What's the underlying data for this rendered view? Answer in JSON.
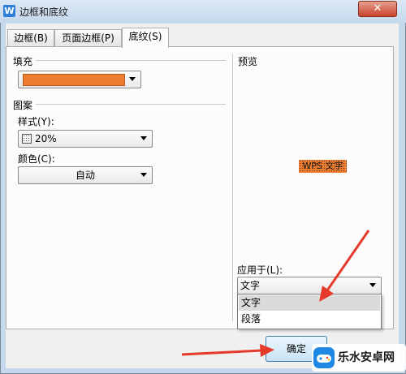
{
  "window": {
    "title": "边框和底纹",
    "close_glyph": "✕"
  },
  "tabs": [
    {
      "label": "边框(B)"
    },
    {
      "label": "页面边框(P)"
    },
    {
      "label": "底纹(S)"
    }
  ],
  "fill": {
    "label": "填充",
    "color": "#ed7d31"
  },
  "pattern": {
    "label": "图案",
    "style_label": "样式(Y):",
    "style_value": "20%",
    "color_label": "颜色(C):",
    "color_value": "自动"
  },
  "preview": {
    "label": "预览",
    "sample_text": "WPS 文字"
  },
  "apply_to": {
    "label": "应用于(L):",
    "value": "文字",
    "options": [
      "文字",
      "段落"
    ]
  },
  "buttons": {
    "ok": "确定"
  },
  "watermark": {
    "text": "乐水安卓网"
  },
  "colors": {
    "accent": "#ed7d31",
    "arrow": "#e53a2a",
    "title_bg": "#c5d8ec"
  }
}
